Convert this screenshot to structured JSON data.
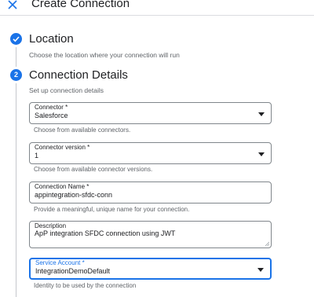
{
  "header": {
    "title": "Create Connection",
    "close_icon": "close-icon"
  },
  "steps": [
    {
      "status": "complete",
      "icon": "check-icon",
      "title": "Location",
      "subtitle": "Choose the location where your connection will run"
    },
    {
      "status": "active",
      "number": "2",
      "title": "Connection Details",
      "subtitle": "Set up connection details"
    }
  ],
  "fields": {
    "connector": {
      "label": "Connector *",
      "value": "Salesforce",
      "hint": "Choose from available connectors."
    },
    "connector_version": {
      "label": "Connector version *",
      "value": "1",
      "hint": "Choose from available connector versions."
    },
    "connection_name": {
      "label": "Connection Name *",
      "value": "appintegration-sfdc-conn",
      "hint": "Provide a meaningful, unique name for your connection."
    },
    "description": {
      "label": "Description",
      "value": "ApP integration SFDC connection using JWT"
    },
    "service_account": {
      "label": "Service Account *",
      "value": "IntegrationDemoDefault",
      "hint": "Identity to be used by the connection"
    }
  },
  "colors": {
    "accent": "#1a73e8",
    "border": "#80868b",
    "hint_text": "#5f6368"
  }
}
